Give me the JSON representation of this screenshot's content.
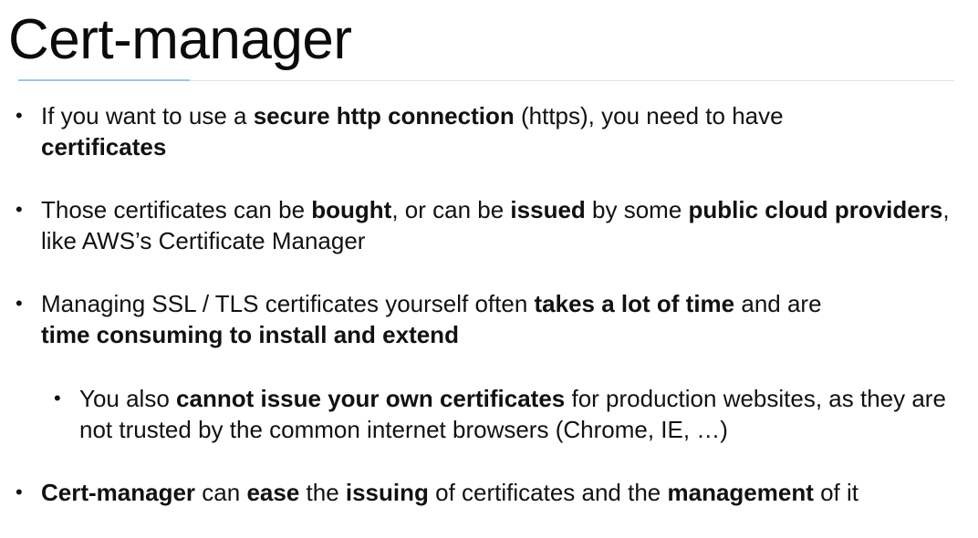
{
  "slide": {
    "title": "Cert-manager",
    "bullets": [
      {
        "level": 1,
        "segments": [
          {
            "text": "If you want to use a ",
            "bold": false
          },
          {
            "text": "secure http connection",
            "bold": true
          },
          {
            "text": " (https), you need to have",
            "bold": false
          },
          {
            "text": "certificates",
            "bold": true
          }
        ]
      },
      {
        "level": 1,
        "segments": [
          {
            "text": "Those certificates can be ",
            "bold": false
          },
          {
            "text": "bought",
            "bold": true
          },
          {
            "text": ", or can be ",
            "bold": false
          },
          {
            "text": "issued",
            "bold": true
          },
          {
            "text": " by some ",
            "bold": false
          },
          {
            "text": "public cloud providers",
            "bold": true
          },
          {
            "text": ", like AWS’s Certificate Manager",
            "bold": false
          }
        ]
      },
      {
        "level": 1,
        "segments": [
          {
            "text": "Managing SSL / TLS certificates yourself often ",
            "bold": false
          },
          {
            "text": "takes a lot of time",
            "bold": true
          },
          {
            "text": " and are ",
            "bold": false
          },
          {
            "text": "time consuming to install and extend",
            "bold": true
          }
        ]
      },
      {
        "level": 2,
        "segments": [
          {
            "text": "You also ",
            "bold": false
          },
          {
            "text": "cannot issue your own certificates",
            "bold": true
          },
          {
            "text": " for production websites, as they are not trusted by the common internet browsers (Chrome, IE, …)",
            "bold": false
          }
        ]
      },
      {
        "level": 1,
        "segments": [
          {
            "text": "Cert-manager",
            "bold": true
          },
          {
            "text": " can ",
            "bold": false
          },
          {
            "text": "ease",
            "bold": true
          },
          {
            "text": " the ",
            "bold": false
          },
          {
            "text": "issuing",
            "bold": true
          },
          {
            "text": " of certificates and the ",
            "bold": false
          },
          {
            "text": "management",
            "bold": true
          },
          {
            "text": " of it",
            "bold": false
          }
        ]
      }
    ]
  }
}
